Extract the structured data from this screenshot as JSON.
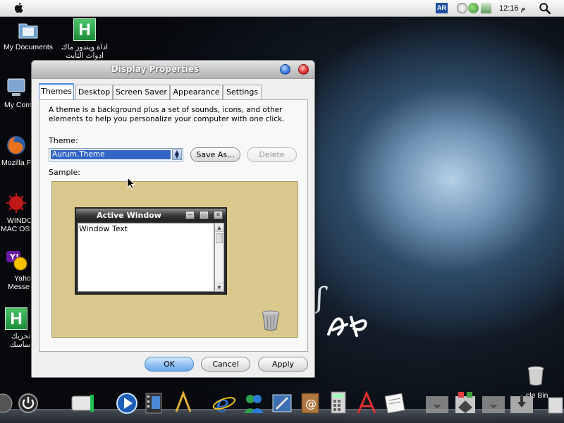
{
  "menubar": {
    "input_language": "AR",
    "clock": "12:16 م"
  },
  "desktop_icons": [
    {
      "name": "my-documents",
      "label": "My Documents",
      "label2": ""
    },
    {
      "name": "arabic-tool",
      "label": "اداة ويندوز ماك",
      "label2": "ادوات الثابت"
    },
    {
      "name": "my-computer",
      "label": "My Com",
      "label2": ""
    },
    {
      "name": "mozilla-firefox",
      "label": "Mozilla F",
      "label2": ""
    },
    {
      "name": "windows-mac-os",
      "label": "WINDO",
      "label2": "MAC OS"
    },
    {
      "name": "yahoo-messenger",
      "label": "Yaho",
      "label2": "Messe"
    },
    {
      "name": "arabic-tool-2",
      "label": "تحريك",
      "label2": "اساسك"
    }
  ],
  "window": {
    "title": "Display Properties",
    "tabs": [
      {
        "label": "Themes",
        "active": true
      },
      {
        "label": "Desktop",
        "active": false
      },
      {
        "label": "Screen Saver",
        "active": false
      },
      {
        "label": "Appearance",
        "active": false
      },
      {
        "label": "Settings",
        "active": false
      }
    ],
    "description": "A theme is a background plus a set of sounds, icons, and other elements to help you personalize your computer with one click.",
    "theme_label": "Theme:",
    "theme_value": "Aurum.Theme",
    "save_as_label": "Save As...",
    "delete_label": "Delete",
    "sample_label": "Sample:",
    "sample_window": {
      "title": "Active Window",
      "body_text": "Window Text"
    },
    "ok_label": "OK",
    "cancel_label": "Cancel",
    "apply_label": "Apply"
  },
  "right_desktop_icon": {
    "label": "cle Bin"
  },
  "colors": {
    "selection": "#3166c6",
    "sample_bg": "#d9c98d",
    "title_close": "#e23232",
    "title_min": "#3a7be0"
  }
}
